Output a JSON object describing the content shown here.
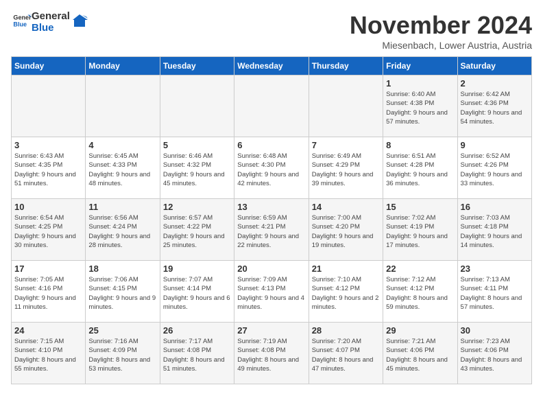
{
  "logo": {
    "text_general": "General",
    "text_blue": "Blue"
  },
  "title": "November 2024",
  "subtitle": "Miesenbach, Lower Austria, Austria",
  "days_of_week": [
    "Sunday",
    "Monday",
    "Tuesday",
    "Wednesday",
    "Thursday",
    "Friday",
    "Saturday"
  ],
  "weeks": [
    [
      {
        "day": "",
        "info": ""
      },
      {
        "day": "",
        "info": ""
      },
      {
        "day": "",
        "info": ""
      },
      {
        "day": "",
        "info": ""
      },
      {
        "day": "",
        "info": ""
      },
      {
        "day": "1",
        "info": "Sunrise: 6:40 AM\nSunset: 4:38 PM\nDaylight: 9 hours and 57 minutes."
      },
      {
        "day": "2",
        "info": "Sunrise: 6:42 AM\nSunset: 4:36 PM\nDaylight: 9 hours and 54 minutes."
      }
    ],
    [
      {
        "day": "3",
        "info": "Sunrise: 6:43 AM\nSunset: 4:35 PM\nDaylight: 9 hours and 51 minutes."
      },
      {
        "day": "4",
        "info": "Sunrise: 6:45 AM\nSunset: 4:33 PM\nDaylight: 9 hours and 48 minutes."
      },
      {
        "day": "5",
        "info": "Sunrise: 6:46 AM\nSunset: 4:32 PM\nDaylight: 9 hours and 45 minutes."
      },
      {
        "day": "6",
        "info": "Sunrise: 6:48 AM\nSunset: 4:30 PM\nDaylight: 9 hours and 42 minutes."
      },
      {
        "day": "7",
        "info": "Sunrise: 6:49 AM\nSunset: 4:29 PM\nDaylight: 9 hours and 39 minutes."
      },
      {
        "day": "8",
        "info": "Sunrise: 6:51 AM\nSunset: 4:28 PM\nDaylight: 9 hours and 36 minutes."
      },
      {
        "day": "9",
        "info": "Sunrise: 6:52 AM\nSunset: 4:26 PM\nDaylight: 9 hours and 33 minutes."
      }
    ],
    [
      {
        "day": "10",
        "info": "Sunrise: 6:54 AM\nSunset: 4:25 PM\nDaylight: 9 hours and 30 minutes."
      },
      {
        "day": "11",
        "info": "Sunrise: 6:56 AM\nSunset: 4:24 PM\nDaylight: 9 hours and 28 minutes."
      },
      {
        "day": "12",
        "info": "Sunrise: 6:57 AM\nSunset: 4:22 PM\nDaylight: 9 hours and 25 minutes."
      },
      {
        "day": "13",
        "info": "Sunrise: 6:59 AM\nSunset: 4:21 PM\nDaylight: 9 hours and 22 minutes."
      },
      {
        "day": "14",
        "info": "Sunrise: 7:00 AM\nSunset: 4:20 PM\nDaylight: 9 hours and 19 minutes."
      },
      {
        "day": "15",
        "info": "Sunrise: 7:02 AM\nSunset: 4:19 PM\nDaylight: 9 hours and 17 minutes."
      },
      {
        "day": "16",
        "info": "Sunrise: 7:03 AM\nSunset: 4:18 PM\nDaylight: 9 hours and 14 minutes."
      }
    ],
    [
      {
        "day": "17",
        "info": "Sunrise: 7:05 AM\nSunset: 4:16 PM\nDaylight: 9 hours and 11 minutes."
      },
      {
        "day": "18",
        "info": "Sunrise: 7:06 AM\nSunset: 4:15 PM\nDaylight: 9 hours and 9 minutes."
      },
      {
        "day": "19",
        "info": "Sunrise: 7:07 AM\nSunset: 4:14 PM\nDaylight: 9 hours and 6 minutes."
      },
      {
        "day": "20",
        "info": "Sunrise: 7:09 AM\nSunset: 4:13 PM\nDaylight: 9 hours and 4 minutes."
      },
      {
        "day": "21",
        "info": "Sunrise: 7:10 AM\nSunset: 4:12 PM\nDaylight: 9 hours and 2 minutes."
      },
      {
        "day": "22",
        "info": "Sunrise: 7:12 AM\nSunset: 4:12 PM\nDaylight: 8 hours and 59 minutes."
      },
      {
        "day": "23",
        "info": "Sunrise: 7:13 AM\nSunset: 4:11 PM\nDaylight: 8 hours and 57 minutes."
      }
    ],
    [
      {
        "day": "24",
        "info": "Sunrise: 7:15 AM\nSunset: 4:10 PM\nDaylight: 8 hours and 55 minutes."
      },
      {
        "day": "25",
        "info": "Sunrise: 7:16 AM\nSunset: 4:09 PM\nDaylight: 8 hours and 53 minutes."
      },
      {
        "day": "26",
        "info": "Sunrise: 7:17 AM\nSunset: 4:08 PM\nDaylight: 8 hours and 51 minutes."
      },
      {
        "day": "27",
        "info": "Sunrise: 7:19 AM\nSunset: 4:08 PM\nDaylight: 8 hours and 49 minutes."
      },
      {
        "day": "28",
        "info": "Sunrise: 7:20 AM\nSunset: 4:07 PM\nDaylight: 8 hours and 47 minutes."
      },
      {
        "day": "29",
        "info": "Sunrise: 7:21 AM\nSunset: 4:06 PM\nDaylight: 8 hours and 45 minutes."
      },
      {
        "day": "30",
        "info": "Sunrise: 7:23 AM\nSunset: 4:06 PM\nDaylight: 8 hours and 43 minutes."
      }
    ]
  ]
}
